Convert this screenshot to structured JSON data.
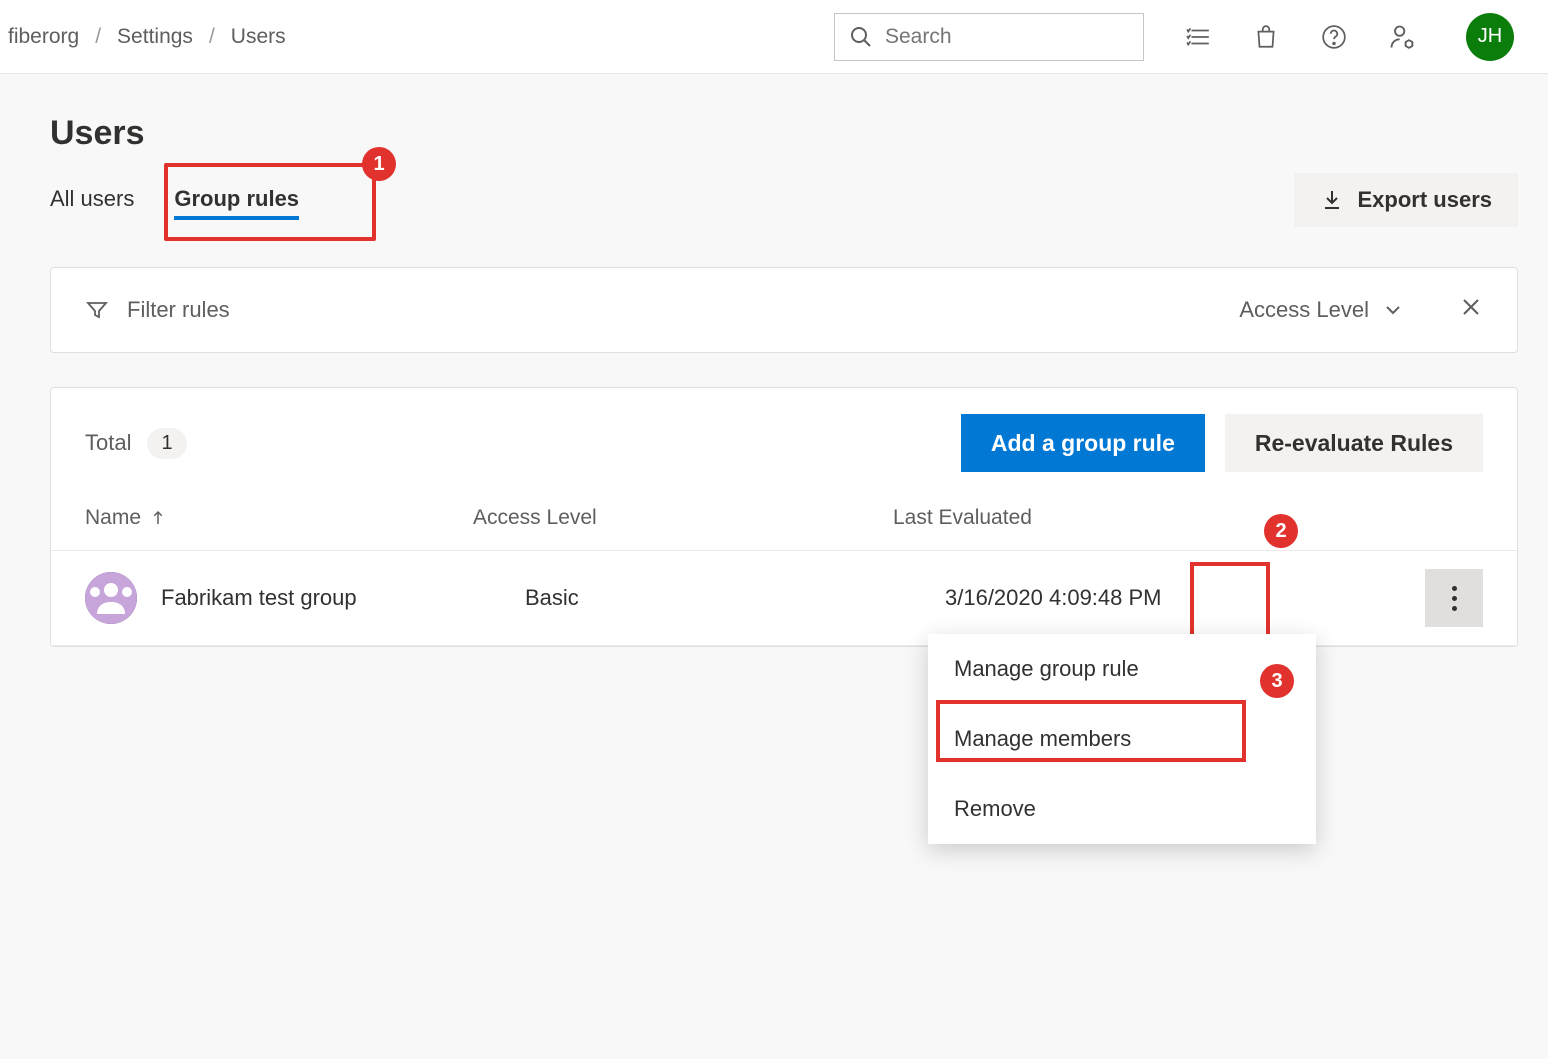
{
  "breadcrumb": {
    "org": "fiberorg",
    "settings": "Settings",
    "users": "Users"
  },
  "search": {
    "placeholder": "Search"
  },
  "avatar": {
    "initials": "JH"
  },
  "page": {
    "title": "Users"
  },
  "tabs": {
    "all_users": "All users",
    "group_rules": "Group rules"
  },
  "export_btn": "Export users",
  "filter": {
    "placeholder": "Filter rules",
    "dropdown_label": "Access Level"
  },
  "card": {
    "total_label": "Total",
    "total_count": "1",
    "add_rule": "Add a group rule",
    "reeval": "Re-evaluate Rules"
  },
  "columns": {
    "name": "Name",
    "access": "Access Level",
    "evaluated": "Last Evaluated"
  },
  "rows": [
    {
      "name": "Fabrikam test group",
      "access": "Basic",
      "evaluated": "3/16/2020 4:09:48 PM"
    }
  ],
  "menu": {
    "manage_rule": "Manage group rule",
    "manage_members": "Manage members",
    "remove": "Remove"
  },
  "callouts": {
    "c1": "1",
    "c2": "2",
    "c3": "3"
  }
}
